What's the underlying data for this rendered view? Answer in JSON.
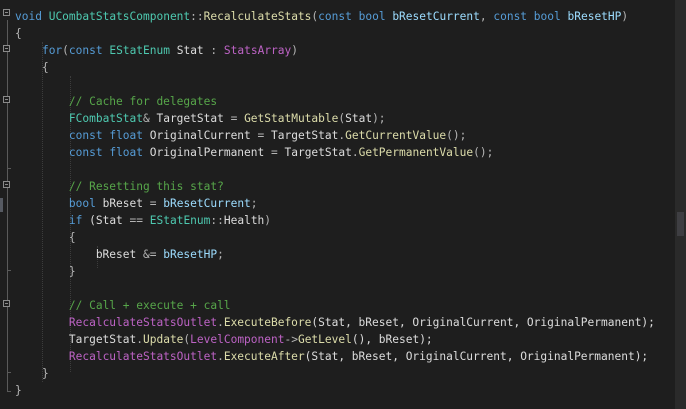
{
  "editor": {
    "lines": [
      [
        {
          "t": "void",
          "c": "kw"
        },
        {
          "t": " ",
          "c": "va"
        },
        {
          "t": "UCombatStatsComponent",
          "c": "ty"
        },
        {
          "t": "::",
          "c": "op"
        },
        {
          "t": "RecalculateStats",
          "c": "fn"
        },
        {
          "t": "(",
          "c": "op"
        },
        {
          "t": "const",
          "c": "kw"
        },
        {
          "t": " ",
          "c": "va"
        },
        {
          "t": "bool",
          "c": "kw"
        },
        {
          "t": " ",
          "c": "va"
        },
        {
          "t": "bResetCurrent",
          "c": "pa"
        },
        {
          "t": ", ",
          "c": "op"
        },
        {
          "t": "const",
          "c": "kw"
        },
        {
          "t": " ",
          "c": "va"
        },
        {
          "t": "bool",
          "c": "kw"
        },
        {
          "t": " ",
          "c": "va"
        },
        {
          "t": "bResetHP",
          "c": "pa"
        },
        {
          "t": ")",
          "c": "op"
        }
      ],
      [
        {
          "t": "{",
          "c": "op"
        }
      ],
      [
        {
          "t": "    ",
          "c": "va"
        },
        {
          "t": "for",
          "c": "kw"
        },
        {
          "t": "(",
          "c": "op"
        },
        {
          "t": "const",
          "c": "kw"
        },
        {
          "t": " ",
          "c": "va"
        },
        {
          "t": "EStatEnum",
          "c": "ty"
        },
        {
          "t": " Stat ",
          "c": "va"
        },
        {
          "t": ":",
          "c": "op"
        },
        {
          "t": " ",
          "c": "va"
        },
        {
          "t": "StatsArray",
          "c": "sb"
        },
        {
          "t": ")",
          "c": "op"
        }
      ],
      [
        {
          "t": "    {",
          "c": "op"
        }
      ],
      [
        {
          "t": "",
          "c": "va"
        }
      ],
      [
        {
          "t": "        ",
          "c": "va"
        },
        {
          "t": "// Cache for delegates",
          "c": "cm"
        }
      ],
      [
        {
          "t": "        ",
          "c": "va"
        },
        {
          "t": "FCombatStat",
          "c": "ty"
        },
        {
          "t": "&",
          "c": "op"
        },
        {
          "t": " TargetStat ",
          "c": "va"
        },
        {
          "t": "=",
          "c": "op"
        },
        {
          "t": " ",
          "c": "va"
        },
        {
          "t": "GetStatMutable",
          "c": "fn"
        },
        {
          "t": "(",
          "c": "op"
        },
        {
          "t": "Stat",
          "c": "va"
        },
        {
          "t": ");",
          "c": "op"
        }
      ],
      [
        {
          "t": "        ",
          "c": "va"
        },
        {
          "t": "const",
          "c": "kw"
        },
        {
          "t": " ",
          "c": "va"
        },
        {
          "t": "float",
          "c": "kw"
        },
        {
          "t": " OriginalCurrent ",
          "c": "va"
        },
        {
          "t": "=",
          "c": "op"
        },
        {
          "t": " TargetStat",
          "c": "va"
        },
        {
          "t": ".",
          "c": "op"
        },
        {
          "t": "GetCurrentValue",
          "c": "fn"
        },
        {
          "t": "();",
          "c": "op"
        }
      ],
      [
        {
          "t": "        ",
          "c": "va"
        },
        {
          "t": "const",
          "c": "kw"
        },
        {
          "t": " ",
          "c": "va"
        },
        {
          "t": "float",
          "c": "kw"
        },
        {
          "t": " OriginalPermanent ",
          "c": "va"
        },
        {
          "t": "=",
          "c": "op"
        },
        {
          "t": " TargetStat",
          "c": "va"
        },
        {
          "t": ".",
          "c": "op"
        },
        {
          "t": "GetPermanentValue",
          "c": "fn"
        },
        {
          "t": "();",
          "c": "op"
        }
      ],
      [
        {
          "t": "",
          "c": "va"
        }
      ],
      [
        {
          "t": "        ",
          "c": "va"
        },
        {
          "t": "// Resetting this stat?",
          "c": "cm"
        }
      ],
      [
        {
          "t": "        ",
          "c": "va"
        },
        {
          "t": "bool",
          "c": "kw"
        },
        {
          "t": " bReset ",
          "c": "va"
        },
        {
          "t": "=",
          "c": "op"
        },
        {
          "t": " ",
          "c": "va"
        },
        {
          "t": "bResetCurrent",
          "c": "pa"
        },
        {
          "t": ";",
          "c": "op"
        }
      ],
      [
        {
          "t": "        ",
          "c": "va"
        },
        {
          "t": "if",
          "c": "kw"
        },
        {
          "t": " (Stat ",
          "c": "va"
        },
        {
          "t": "==",
          "c": "op"
        },
        {
          "t": " ",
          "c": "va"
        },
        {
          "t": "EStatEnum",
          "c": "ty"
        },
        {
          "t": "::",
          "c": "op"
        },
        {
          "t": "Health",
          "c": "va"
        },
        {
          "t": ")",
          "c": "op"
        }
      ],
      [
        {
          "t": "        {",
          "c": "op"
        }
      ],
      [
        {
          "t": "            bReset ",
          "c": "va"
        },
        {
          "t": "&=",
          "c": "op"
        },
        {
          "t": " ",
          "c": "va"
        },
        {
          "t": "bResetHP",
          "c": "pa"
        },
        {
          "t": ";",
          "c": "op"
        }
      ],
      [
        {
          "t": "        }",
          "c": "op"
        }
      ],
      [
        {
          "t": "",
          "c": "va"
        }
      ],
      [
        {
          "t": "        ",
          "c": "va"
        },
        {
          "t": "// Call + execute + call",
          "c": "cm"
        }
      ],
      [
        {
          "t": "        ",
          "c": "va"
        },
        {
          "t": "RecalculateStatsOutlet",
          "c": "sb"
        },
        {
          "t": ".",
          "c": "op"
        },
        {
          "t": "ExecuteBefore",
          "c": "fn"
        },
        {
          "t": "(Stat, bReset, OriginalCurrent, OriginalPermanent);",
          "c": "va"
        }
      ],
      [
        {
          "t": "        TargetStat",
          "c": "va"
        },
        {
          "t": ".",
          "c": "op"
        },
        {
          "t": "Update",
          "c": "fn"
        },
        {
          "t": "(",
          "c": "op"
        },
        {
          "t": "LevelComponent",
          "c": "sb"
        },
        {
          "t": "->",
          "c": "op"
        },
        {
          "t": "GetLevel",
          "c": "fn"
        },
        {
          "t": "(), bReset);",
          "c": "va"
        }
      ],
      [
        {
          "t": "        ",
          "c": "va"
        },
        {
          "t": "RecalculateStatsOutlet",
          "c": "sb"
        },
        {
          "t": ".",
          "c": "op"
        },
        {
          "t": "ExecuteAfter",
          "c": "fn"
        },
        {
          "t": "(Stat, bReset, OriginalCurrent, OriginalPermanent);",
          "c": "va"
        }
      ],
      [
        {
          "t": "    }",
          "c": "op"
        }
      ],
      [
        {
          "t": "}",
          "c": "op"
        }
      ]
    ]
  }
}
